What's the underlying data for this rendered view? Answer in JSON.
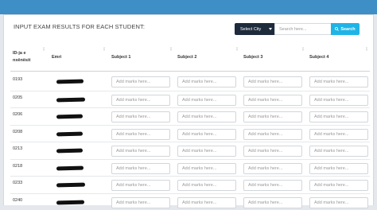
{
  "header": {
    "title": "INPUT EXAM RESULTS FOR EACH STUDENT:",
    "select_city_label": "Select City",
    "search_placeholder": "Search here...",
    "search_button_label": "Search"
  },
  "table": {
    "columns": [
      "ID-ja e nxënësit",
      "Emri",
      "Subject 1",
      "Subject 2",
      "Subject 3",
      "Subject 4"
    ],
    "mark_placeholder": "Add marks here...",
    "rows": [
      {
        "id": "0193"
      },
      {
        "id": "0205"
      },
      {
        "id": "0206"
      },
      {
        "id": "0208"
      },
      {
        "id": "0213"
      },
      {
        "id": "0218"
      },
      {
        "id": "0233"
      },
      {
        "id": "0240"
      }
    ]
  },
  "colors": {
    "topbar": "#3d8fc6",
    "select_city_bg": "#1e2b3c",
    "search_button_bg": "#1fb4e6"
  },
  "icons": {
    "search_button": "search-icon",
    "select_city": "caret-down-icon",
    "column_sort": "sort-icon"
  }
}
